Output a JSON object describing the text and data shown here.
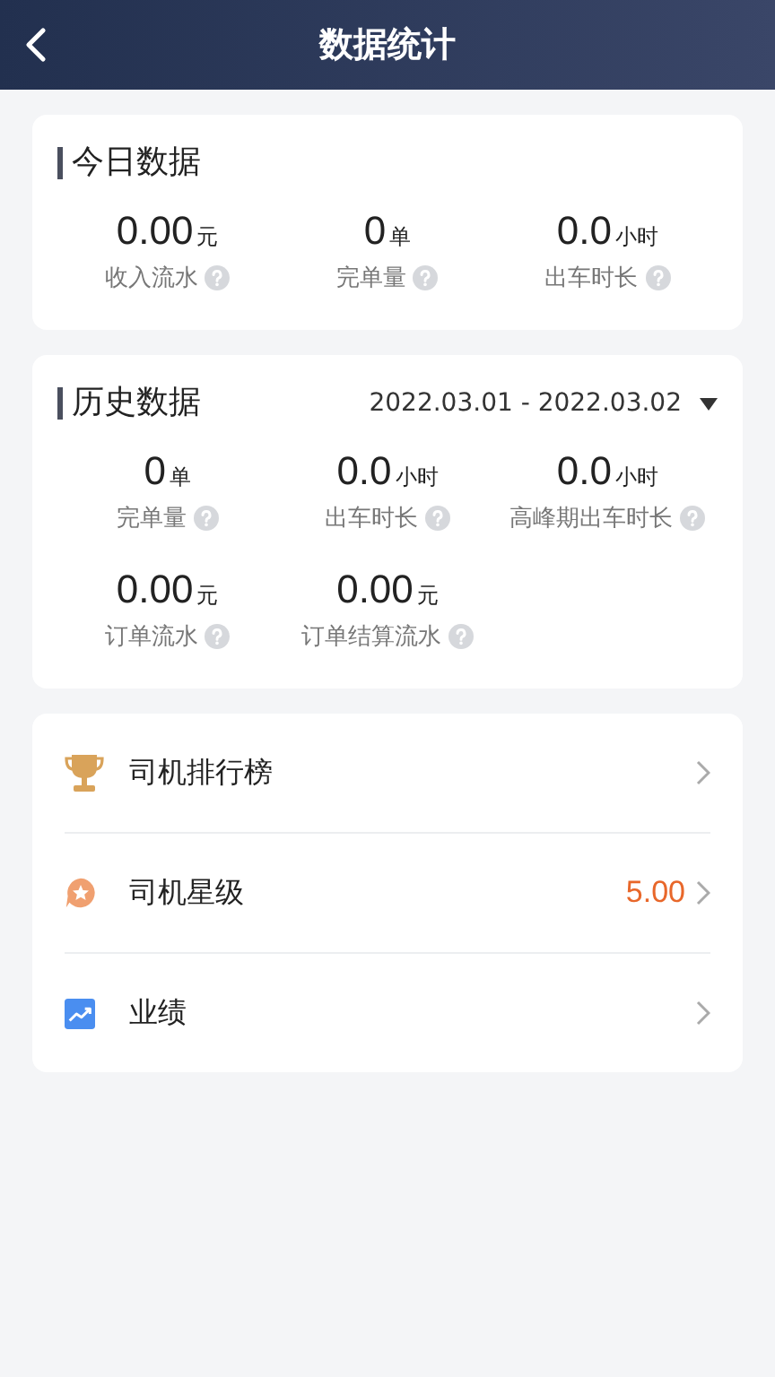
{
  "header": {
    "title": "数据统计"
  },
  "today": {
    "title": "今日数据",
    "stats": [
      {
        "value": "0.00",
        "unit": "元",
        "label": "收入流水"
      },
      {
        "value": "0",
        "unit": "单",
        "label": "完单量"
      },
      {
        "value": "0.0",
        "unit": "小时",
        "label": "出车时长"
      }
    ]
  },
  "history": {
    "title": "历史数据",
    "date_range": "2022.03.01 - 2022.03.02",
    "stats": [
      {
        "value": "0",
        "unit": "单",
        "label": "完单量"
      },
      {
        "value": "0.0",
        "unit": "小时",
        "label": "出车时长"
      },
      {
        "value": "0.0",
        "unit": "小时",
        "label": "高峰期出车时长"
      },
      {
        "value": "0.00",
        "unit": "元",
        "label": "订单流水"
      },
      {
        "value": "0.00",
        "unit": "元",
        "label": "订单结算流水"
      }
    ]
  },
  "menu": [
    {
      "label": "司机排行榜"
    },
    {
      "label": "司机星级",
      "value": "5.00"
    },
    {
      "label": "业绩"
    }
  ]
}
